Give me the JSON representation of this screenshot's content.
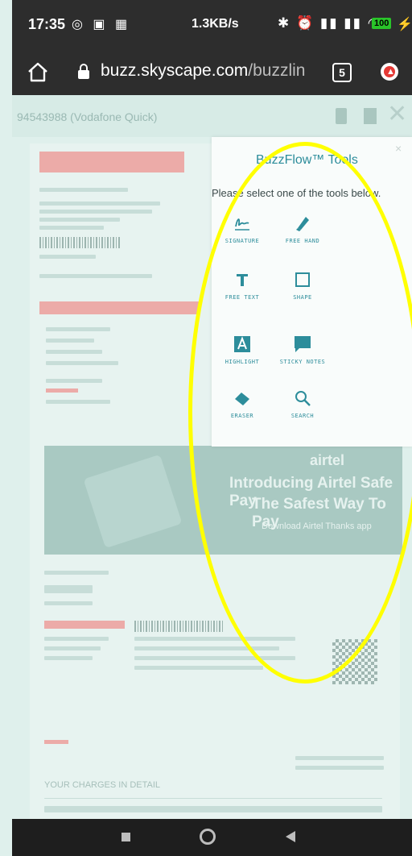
{
  "status_bar": {
    "time": "17:35",
    "left_icons": "◎ ▣ ▦",
    "net_rate": "1.3KB/s",
    "right_icons": "✱ ⏰ ▮▮ ▮▮ ◠",
    "battery": "100",
    "charging_glyph": "⚡"
  },
  "browser": {
    "url_host": "buzz.skyscape.com",
    "url_path": "/buzzlin",
    "tab_count": "5"
  },
  "document": {
    "title": "94543988 (Vodafone Quick)",
    "banner": {
      "brand": "airtel",
      "headline_1": "Introducing Airtel Safe Pay",
      "headline_2": "The Safest Way To Pay",
      "cta": "Download Airtel Thanks app"
    },
    "charges_heading": "YOUR CHARGES IN DETAIL"
  },
  "tools_panel": {
    "title": "BuzzFlow™ Tools",
    "subtitle": "Please select one of the tools below.",
    "close_glyph": "×",
    "tools": [
      {
        "label": "SIGNATURE"
      },
      {
        "label": "FREE HAND"
      },
      {
        "label": "FREE TEXT"
      },
      {
        "label": "SHAPE"
      },
      {
        "label": "HIGHLIGHT"
      },
      {
        "label": "STICKY NOTES"
      },
      {
        "label": "ERASER"
      },
      {
        "label": "SEARCH"
      }
    ]
  },
  "colors": {
    "accent": "#2d8d9b",
    "annotation_ring": "#ffff00",
    "chrome_bg": "#2d2d2d"
  }
}
